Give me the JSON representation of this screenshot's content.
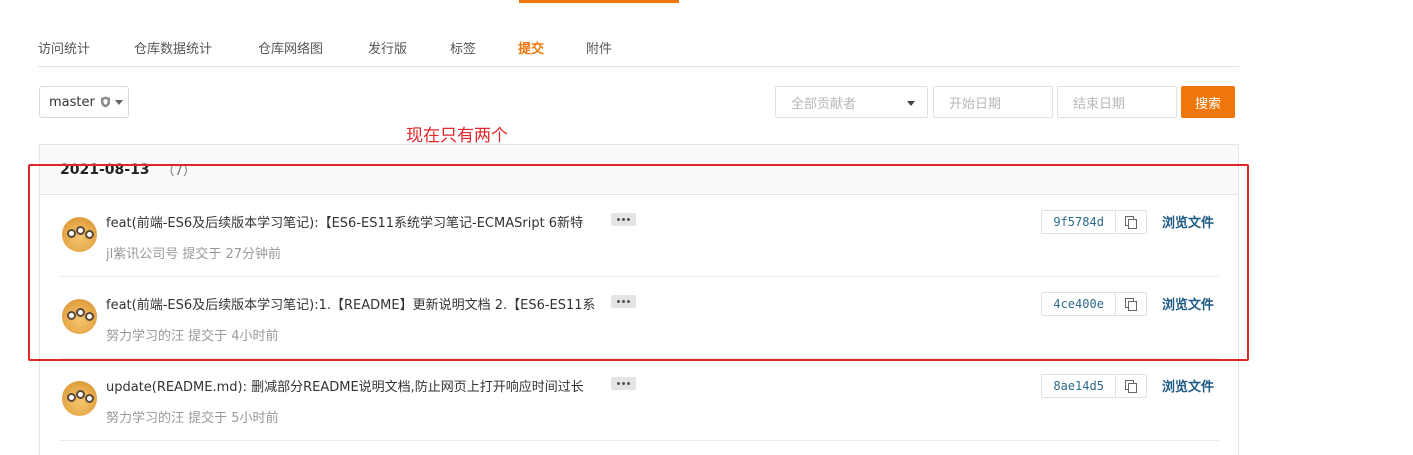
{
  "tabs": [
    {
      "label": "访问统计",
      "active": false
    },
    {
      "label": "仓库数据统计",
      "active": false
    },
    {
      "label": "仓库网络图",
      "active": false
    },
    {
      "label": "发行版",
      "active": false
    },
    {
      "label": "标签",
      "active": false
    },
    {
      "label": "提交",
      "active": true
    },
    {
      "label": "附件",
      "active": false
    }
  ],
  "branch": {
    "value": "master",
    "icon": "shield-icon"
  },
  "filters": {
    "contributor": "全部贡献者",
    "start_date_placeholder": "开始日期",
    "end_date_placeholder": "结束日期",
    "search_label": "搜索"
  },
  "annotation": {
    "text": "现在只有两个",
    "color": "#e0262b"
  },
  "commit_group": {
    "date": "2021-08-13",
    "count": "（7）",
    "commits": [
      {
        "message": "feat(前端-ES6及后续版本学习笔记):【ES6-ES11系统学习笔记-ECMASript 6新特",
        "meta": "jl紫讯公司号 提交于 27分钟前",
        "sha": "9f5784d",
        "browse_label": "浏览文件"
      },
      {
        "message": "feat(前端-ES6及后续版本学习笔记):1.【README】更新说明文档 2.【ES6-ES11系",
        "meta": "努力学习的汪 提交于 4小时前",
        "sha": "4ce400e",
        "browse_label": "浏览文件"
      },
      {
        "message": "update(README.md): 删减部分README说明文档,防止网页上打开响应时间过长",
        "meta": "努力学习的汪 提交于 5小时前",
        "sha": "8ae14d5",
        "browse_label": "浏览文件"
      }
    ]
  },
  "colors": {
    "accent": "#f0760a",
    "link": "#1d5a85",
    "sha": "#2e6a8a",
    "annotation": "#e0262b"
  }
}
